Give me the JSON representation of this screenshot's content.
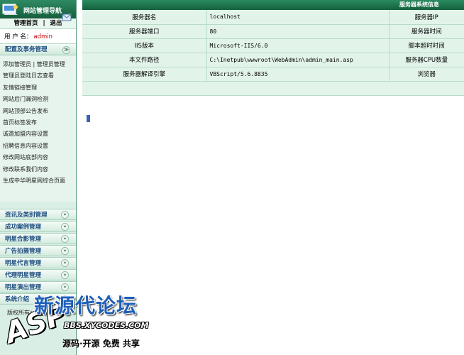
{
  "sidebar": {
    "title": "网站管理导航",
    "links": {
      "home": "管理首页",
      "sep": "|",
      "logout": "退出"
    },
    "user": {
      "label": "用 户 名：",
      "name": "admin"
    },
    "config_section": {
      "title": "配置及事务管理",
      "toggle": "≫"
    },
    "config_items": [
      "添加管理员 | 管理员管理",
      "管理员登陆日志查看",
      "友情链接管理",
      "网站后门漏洞检测",
      "网站顶部公告发布",
      "首页标签发布",
      "诚邀加盟内容设置",
      "招聘信息内容设置",
      "修改网站底部内容",
      "修改联系我们内容",
      "生成中华明星网综合页面"
    ],
    "categories": [
      {
        "label": "资讯及类别管理",
        "toggle": "»"
      },
      {
        "label": "成功案例管理",
        "toggle": "»"
      },
      {
        "label": "明星合影管理",
        "toggle": "»"
      },
      {
        "label": "广告拍摄管理",
        "toggle": "»"
      },
      {
        "label": "明星代言管理",
        "toggle": "»"
      },
      {
        "label": "代理明星管理",
        "toggle": "»"
      },
      {
        "label": "明星演出管理",
        "toggle": "»"
      },
      {
        "label": "系统介绍",
        "toggle": "»"
      }
    ],
    "copyright": "版权所有："
  },
  "main": {
    "header_title": "服务器系统信息",
    "rows": [
      {
        "label": "服务器名",
        "value": "localhost",
        "right": "服务器IP"
      },
      {
        "label": "服务器端口",
        "value": "80",
        "right": "服务器时间"
      },
      {
        "label": "IIS版本",
        "value": "Microsoft-IIS/6.0",
        "right": "脚本超时时间"
      },
      {
        "label": "本文件路径",
        "value": "C:\\Inetpub\\wwwroot\\WebAdmin\\admin_main.asp",
        "right": "服务器CPU数量"
      },
      {
        "label": "服务器解译引擎",
        "value": "VBScript/5.6.8835",
        "right": "浏览器"
      }
    ]
  },
  "watermark": {
    "cn": "新源代论坛",
    "asp": "ASP",
    "url": "BBS.XYCODES.COM",
    "slogan": "源码·开源 免费 共享"
  },
  "colors": {
    "header_green": "#17613f",
    "sidebar_bg": "#d9efe5",
    "table_bg": "#e2f4ea",
    "link_blue": "#1e4d80",
    "username_red": "#c00000"
  }
}
